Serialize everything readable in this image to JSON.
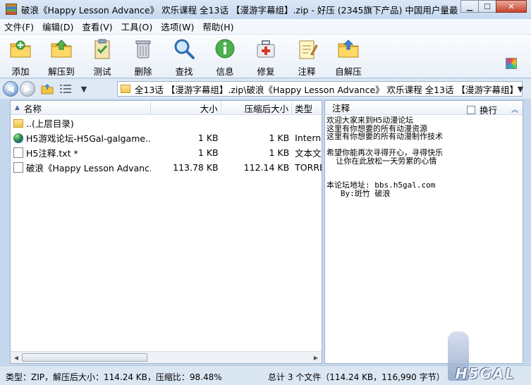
{
  "window": {
    "title": "破浪《Happy Lesson Advance》 欢乐课程 全13话 【漫游字幕组】.zip - 好压 (2345旗下产品) 中国用户量最大..."
  },
  "menu": [
    {
      "label": "文件(F)"
    },
    {
      "label": "编辑(D)"
    },
    {
      "label": "查看(V)"
    },
    {
      "label": "工具(O)"
    },
    {
      "label": "选项(W)"
    },
    {
      "label": "帮助(H)"
    }
  ],
  "toolbar": [
    {
      "label": "添加",
      "icon": "add-folder-icon"
    },
    {
      "label": "解压到",
      "icon": "extract-folder-icon"
    },
    {
      "label": "测试",
      "icon": "test-clipboard-icon"
    },
    {
      "label": "删除",
      "icon": "trash-icon"
    },
    {
      "label": "查找",
      "icon": "magnifier-icon"
    },
    {
      "label": "信息",
      "icon": "info-icon"
    },
    {
      "label": "修复",
      "icon": "repair-kit-icon"
    },
    {
      "label": "注释",
      "icon": "comment-notepad-icon"
    },
    {
      "label": "自解压",
      "icon": "self-extract-icon"
    }
  ],
  "address": {
    "path": "全13话 【漫游字幕组】.zip\\破浪《Happy Lesson Advance》 欢乐课程 全13话 【漫游字幕组】"
  },
  "files": {
    "columns": {
      "name": "名称",
      "size": "大小",
      "packed": "压缩后大小",
      "type": "类型"
    },
    "rows": [
      {
        "name": "..(上层目录)",
        "size": "",
        "packed": "",
        "type": "",
        "icon": "folder-icon"
      },
      {
        "name": "H5游戏论坛-H5Gal-galgame...",
        "size": "1 KB",
        "packed": "1 KB",
        "type": "Interne",
        "icon": "globe-icon"
      },
      {
        "name": "H5注释.txt *",
        "size": "1 KB",
        "packed": "1 KB",
        "type": "文本文",
        "icon": "text-file-icon"
      },
      {
        "name": "破浪《Happy Lesson Advanc...",
        "size": "113.78 KB",
        "packed": "112.14 KB",
        "type": "TORRE",
        "icon": "file-icon"
      }
    ]
  },
  "comment": {
    "header": "注释",
    "wrap_label": "换行",
    "lines": [
      "欢迎大家来到H5动漫论坛",
      "这里有你想要的所有动漫资源",
      "这里有你想要的所有动漫制作技术",
      "",
      "希望你能再次寻得开心，寻得快乐",
      "  让你在此放松一天劳累的心情",
      "",
      "",
      "本论坛地址: bbs.h5gal.com",
      "   By:斑竹 破浪"
    ]
  },
  "status": {
    "left": "类型：ZIP，解压后大小：114.24 KB，压缩比：98.48%",
    "right": "总计 3 个文件（114.24 KB，116,990 字节）"
  },
  "watermark": {
    "text": "H5GAL"
  }
}
